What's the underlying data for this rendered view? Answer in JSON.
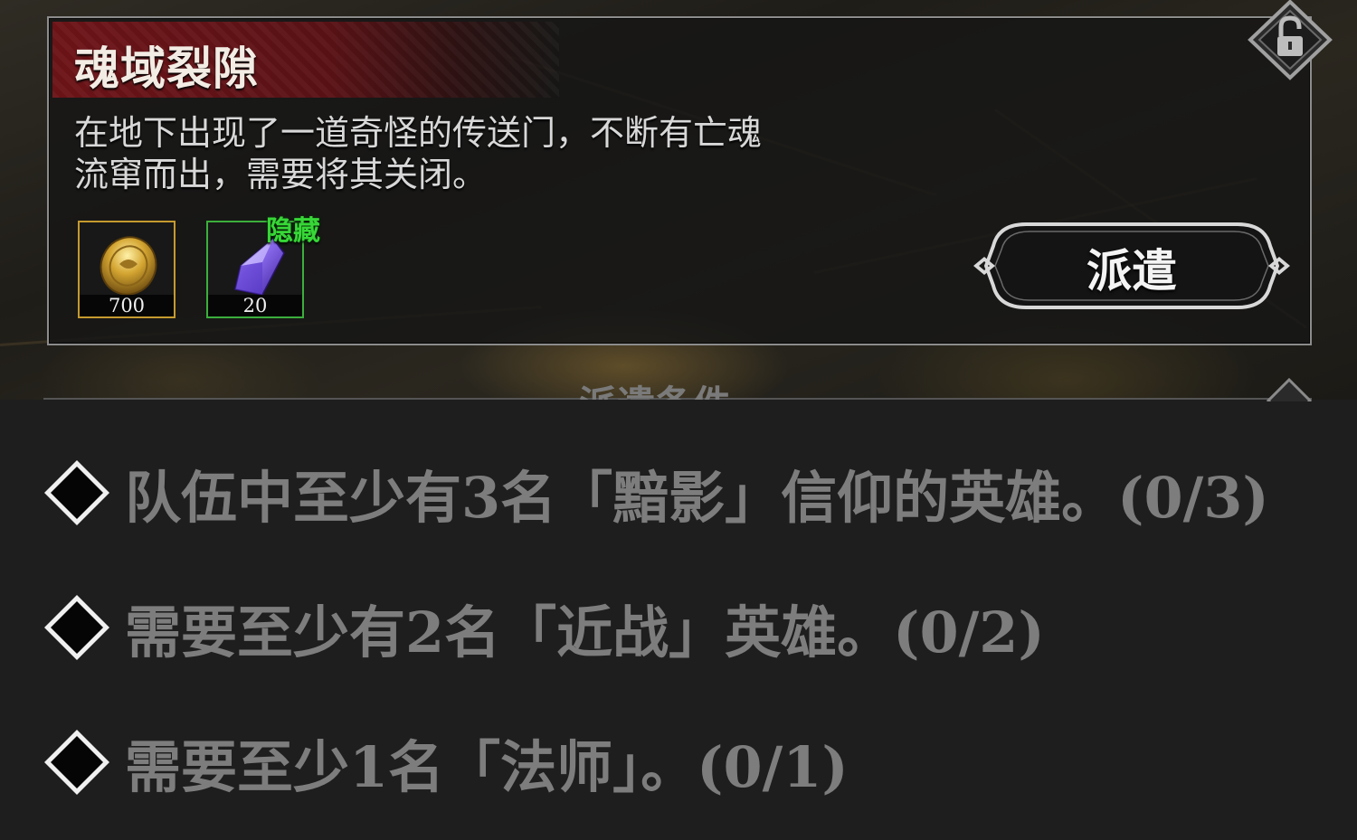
{
  "mission": {
    "title": "魂域裂隙",
    "description_lines": [
      "在地下出现了一道奇怪的传送门，不断有亡魂",
      "流窜而出，需要将其关闭。"
    ],
    "rewards": [
      {
        "icon": "gold-coin-icon",
        "count": "700",
        "rarity_color": "#c59a2e"
      },
      {
        "icon": "purple-crystal-icon",
        "count": "20",
        "rarity_color": "#3cae3c"
      }
    ],
    "hidden_tag": "隐藏",
    "dispatch_label": "派遣",
    "lock_icon": "unlocked-padlock-icon"
  },
  "conditions": {
    "section_title": "派遣条件",
    "items": [
      "队伍中至少有3名「黯影」信仰的英雄。(0/3)",
      "需要至少有2名「近战」英雄。(0/2)",
      "需要至少1名「法师」。(0/1)"
    ]
  },
  "colors": {
    "title_bar": "#6e1418",
    "panel_border": "#8c8c8c",
    "hidden_tag": "#37d737",
    "condition_text": "#7d7d7d",
    "lower_background": "#1e1e1e"
  }
}
